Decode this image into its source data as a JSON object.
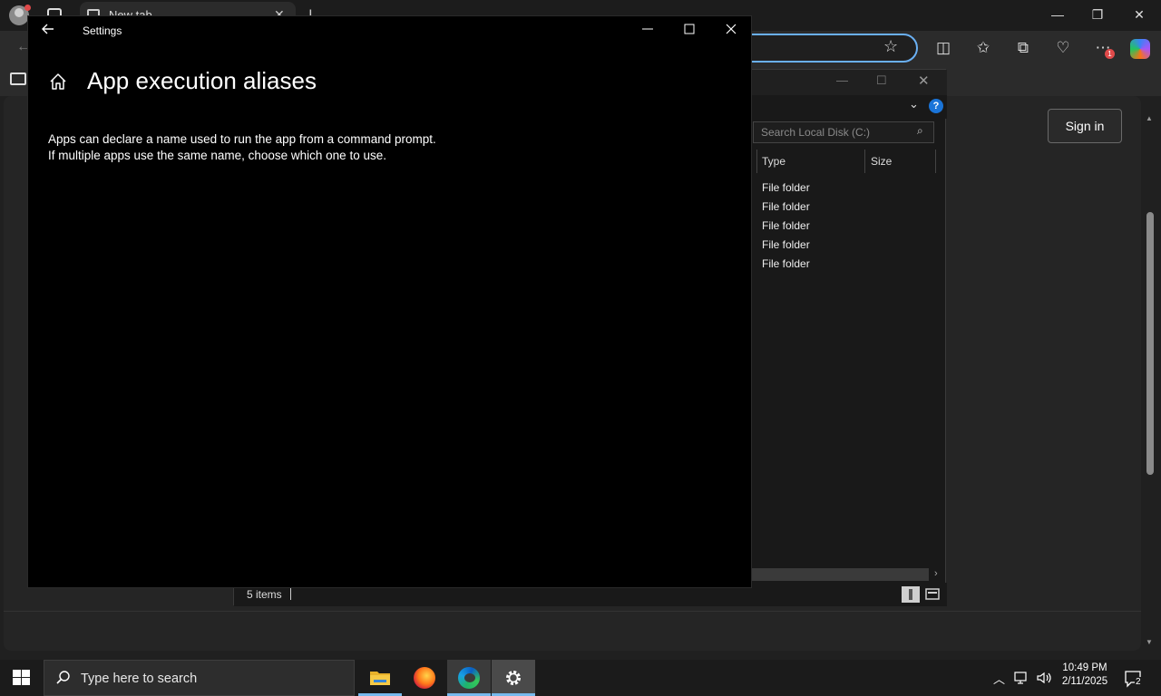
{
  "browser": {
    "tab_title": "New tab",
    "signin_label": "Sign in",
    "notification_count": "1",
    "colors": {
      "accent": "#6ab0f3"
    }
  },
  "explorer": {
    "search_placeholder": "Search Local Disk (C:)",
    "columns": [
      "Type",
      "Size"
    ],
    "rows": [
      "File folder",
      "File folder",
      "File folder",
      "File folder",
      "File folder"
    ],
    "status": "5 items",
    "help": "?"
  },
  "settings": {
    "window_title": "Settings",
    "heading": "App execution aliases",
    "description_line1": "Apps can declare a name used to run the app from a command prompt.",
    "description_line2": "If multiple apps use the same name, choose which one to use."
  },
  "taskbar": {
    "search_placeholder": "Type here to search",
    "apps": [
      "file-explorer-icon",
      "firefox-icon",
      "edge-icon",
      "settings-gear-icon"
    ],
    "time": "10:49 PM",
    "date": "2/11/2025",
    "notification_count": "2",
    "colors": {
      "active_indicator": "#76b9ed"
    }
  }
}
